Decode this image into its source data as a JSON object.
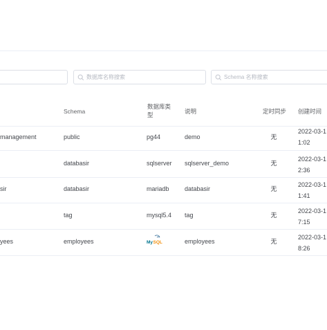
{
  "search": {
    "name_placeholder": "",
    "database_placeholder": "数据库名称搜索",
    "schema_placeholder": "Schema 名称搜索"
  },
  "table": {
    "columns": {
      "schema": "Schema",
      "db_type_line1": "数据库类",
      "db_type_line2": "型",
      "description": "说明",
      "sync": "定时同步",
      "created": "创建时间"
    },
    "rows": [
      {
        "name": "management",
        "schema": "public",
        "db_type": "pg44",
        "description": "demo",
        "sync": "无",
        "created_line1": "2022-03-1",
        "created_line2": "1:02"
      },
      {
        "name": "",
        "schema": "databasir",
        "db_type": "sqlserver",
        "description": "sqlserver_demo",
        "sync": "无",
        "created_line1": "2022-03-1",
        "created_line2": "2:36"
      },
      {
        "name": "sir",
        "schema": "databasir",
        "db_type": "mariadb",
        "description": "databasir",
        "sync": "无",
        "created_line1": "2022-03-1",
        "created_line2": "1:41"
      },
      {
        "name": "",
        "schema": "tag",
        "db_type": "mysql5.4",
        "description": "tag",
        "sync": "无",
        "created_line1": "2022-03-1",
        "created_line2": "7:15"
      },
      {
        "name": "yees",
        "schema": "employees",
        "db_type": "MySQL",
        "db_type_icon": "mysql-logo-icon",
        "description": "employees",
        "sync": "无",
        "created_line1": "2022-03-1",
        "created_line2": "8:26"
      }
    ]
  }
}
